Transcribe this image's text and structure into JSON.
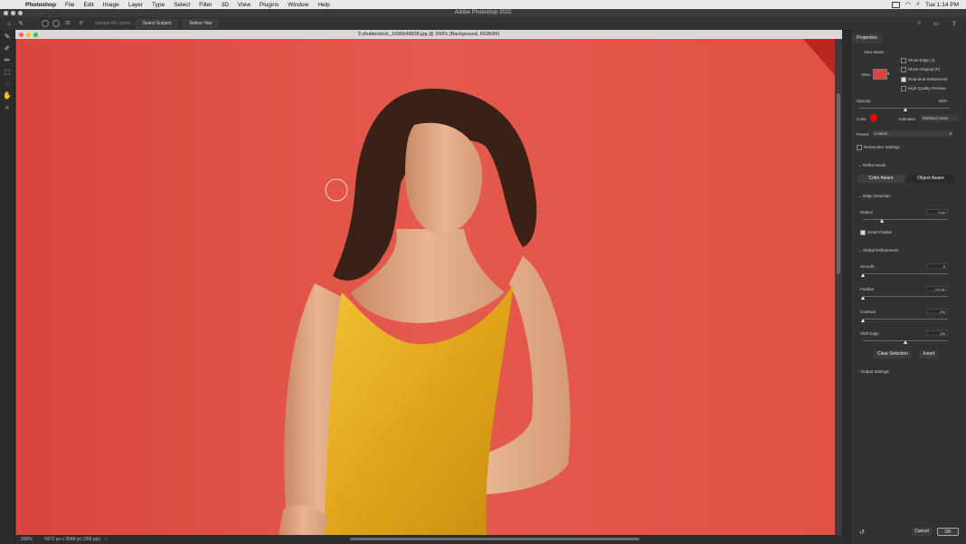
{
  "menubar": {
    "app": "Photoshop",
    "items": [
      "File",
      "Edit",
      "Image",
      "Layer",
      "Type",
      "Select",
      "Filter",
      "3D",
      "View",
      "Plugins",
      "Window",
      "Help"
    ],
    "clock": "Tue 1:14 PM"
  },
  "window": {
    "title": "Adobe Photoshop 2022"
  },
  "options": {
    "brush_size": "25",
    "angle": "0°",
    "sample_all_layers": "Sample All Layers",
    "select_subject": "Select Subject",
    "refine_hair": "Refine Hair"
  },
  "document": {
    "title": "3 shutterstock_1695649828.jpg @ 200% (Background, RGB/8#)",
    "zoom": "200%",
    "dimensions": "5472 px x 3648 px (300 ppi)"
  },
  "properties": {
    "tab": "Properties",
    "view_mode_label": "View Mode",
    "view_label": "View:",
    "show_edge": "Show Edge (J)",
    "show_original": "Show Original (P)",
    "realtime": "Real-time Refinement",
    "hq_preview": "High Quality Preview",
    "opacity_label": "Opacity",
    "opacity_value": "50%",
    "color_label": "Color",
    "indicates_label": "Indicates",
    "indicates_value": "Masked Areas",
    "preset_label": "Preset:",
    "preset_value": "Custom",
    "remember": "Remember Settings",
    "refine_mode": "Refine Mode",
    "color_aware": "Color Aware",
    "object_aware": "Object Aware",
    "edge_detection": "Edge Detection",
    "radius_label": "Radius",
    "radius_value": "0 px",
    "smart_radius": "Smart Radius",
    "global_refinements": "Global Refinements",
    "smooth_label": "Smooth",
    "smooth_value": "0",
    "feather_label": "Feather",
    "feather_value": "0.0 px",
    "contrast_label": "Contrast",
    "contrast_value": "0%",
    "shift_label": "Shift Edge",
    "shift_value": "0%",
    "clear_selection": "Clear Selection",
    "invert": "Invert",
    "output_settings": "Output Settings",
    "cancel": "Cancel",
    "ok": "OK"
  },
  "colors": {
    "canvas_bg": "#e2574a",
    "dress": "#e8b020",
    "hair": "#3a2118",
    "skin": "#e0a985",
    "mask_color": "#ff0000"
  }
}
